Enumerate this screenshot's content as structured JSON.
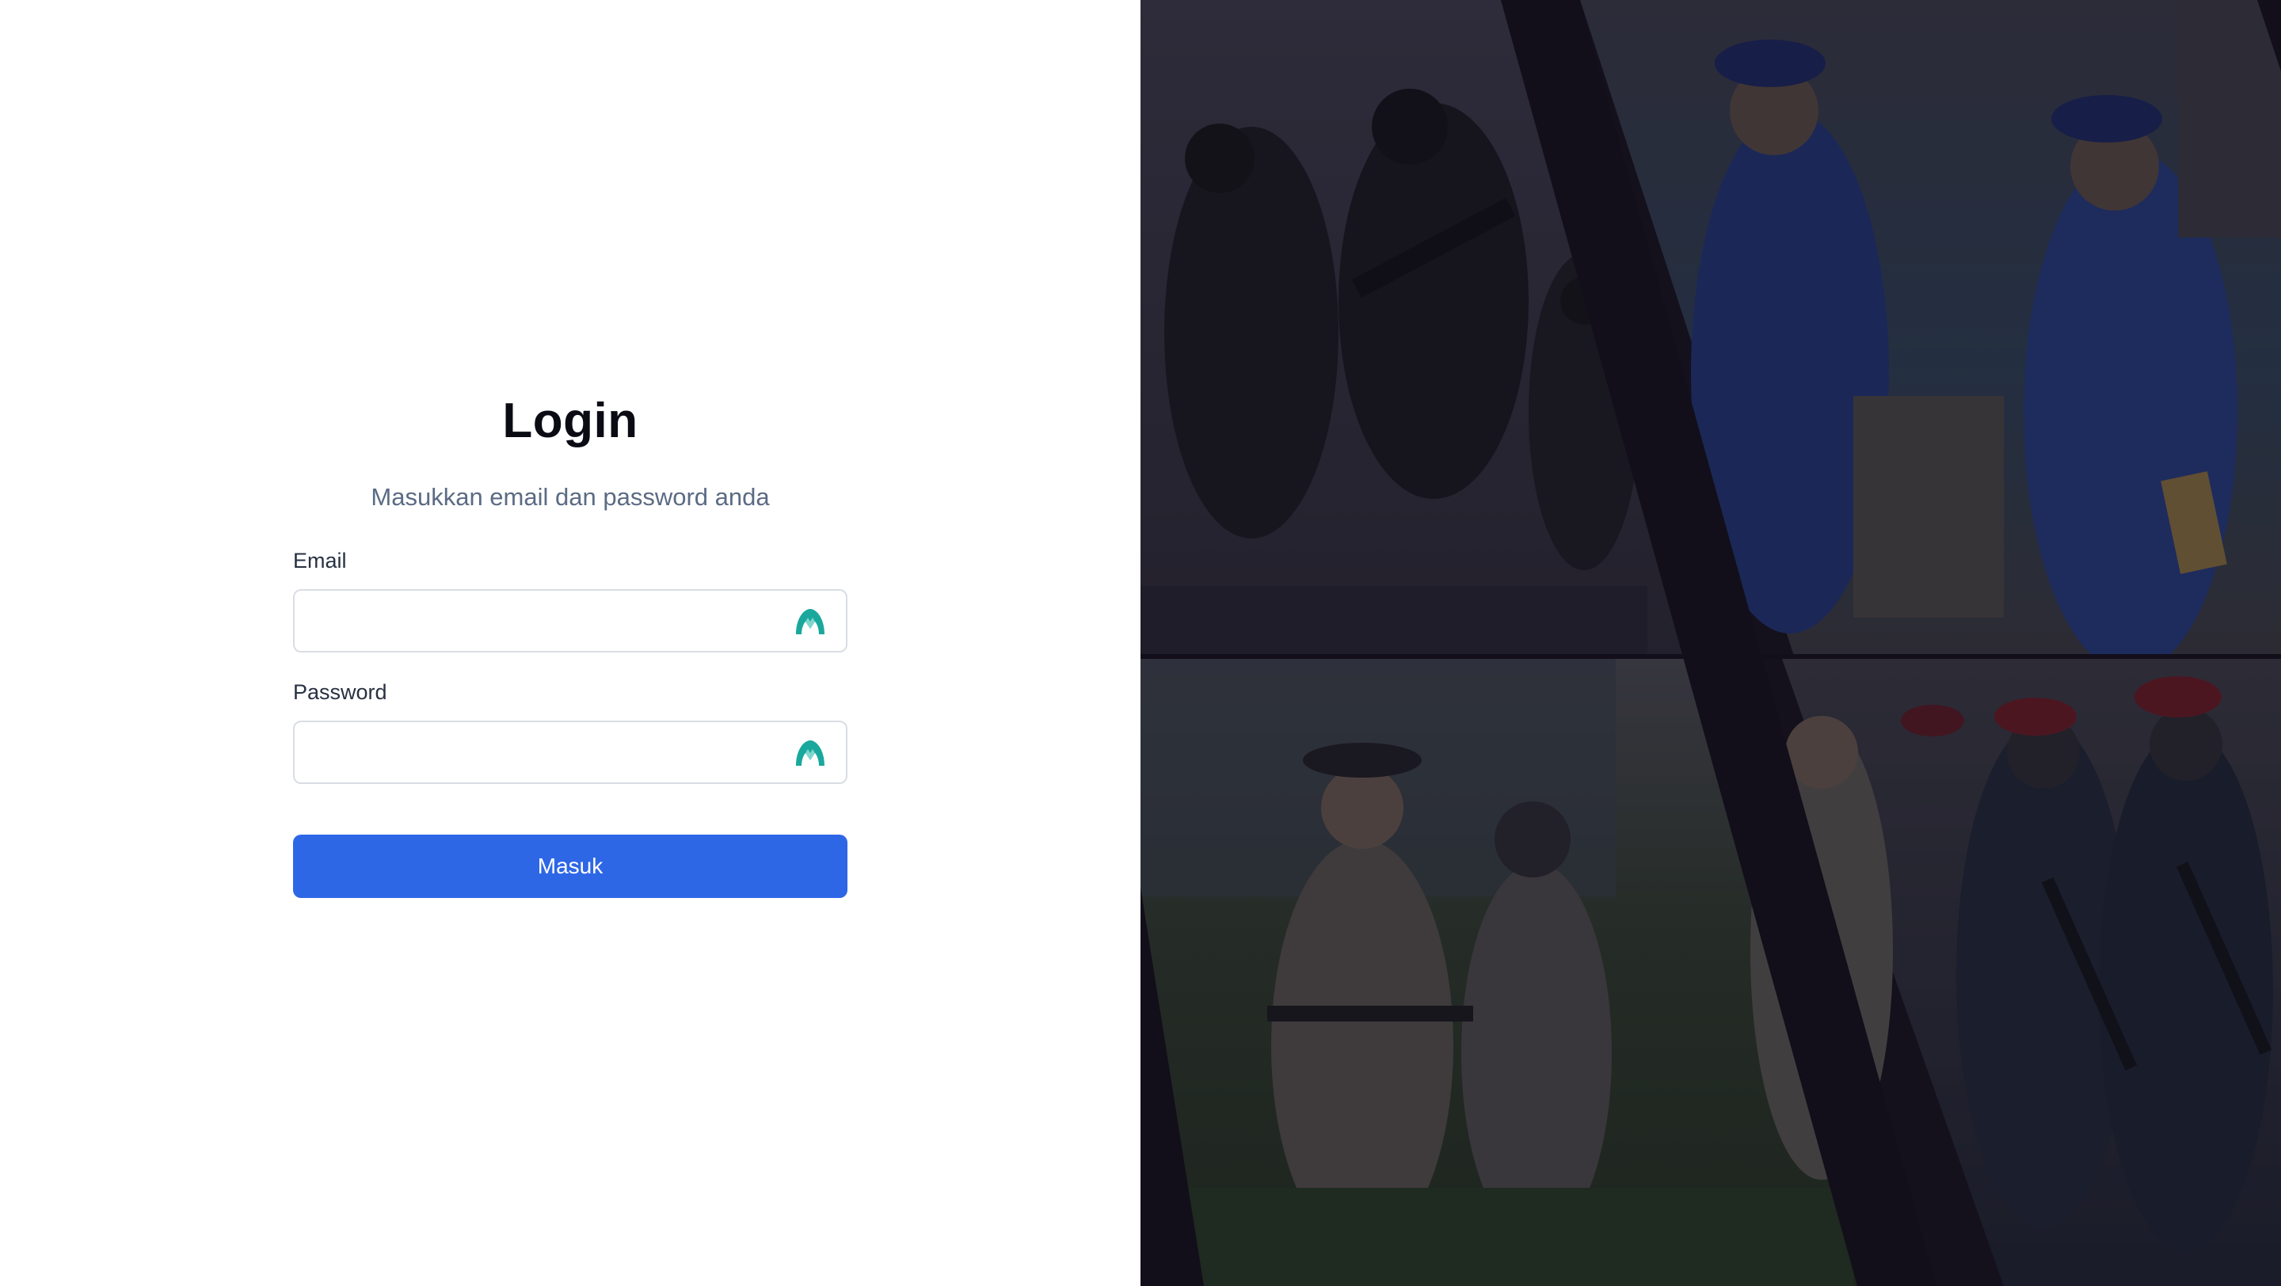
{
  "login": {
    "title": "Login",
    "subtitle": "Masukkan email dan password anda",
    "email": {
      "label": "Email",
      "value": "",
      "placeholder": "",
      "icon": "password-manager-icon"
    },
    "password": {
      "label": "Password",
      "value": "",
      "placeholder": "",
      "icon": "password-manager-icon"
    },
    "submit_label": "Masuk"
  },
  "collage": {
    "images": [
      "photo-armed-soldiers",
      "photo-police-officers-blue-uniform",
      "photo-police-ceremony",
      "photo-red-beret-soldiers"
    ]
  },
  "colors": {
    "primary_button": "#2e67e6",
    "icon_accent": "#1aa89c",
    "subtitle": "#5b6b84",
    "collage_overlay": "#14111e"
  }
}
